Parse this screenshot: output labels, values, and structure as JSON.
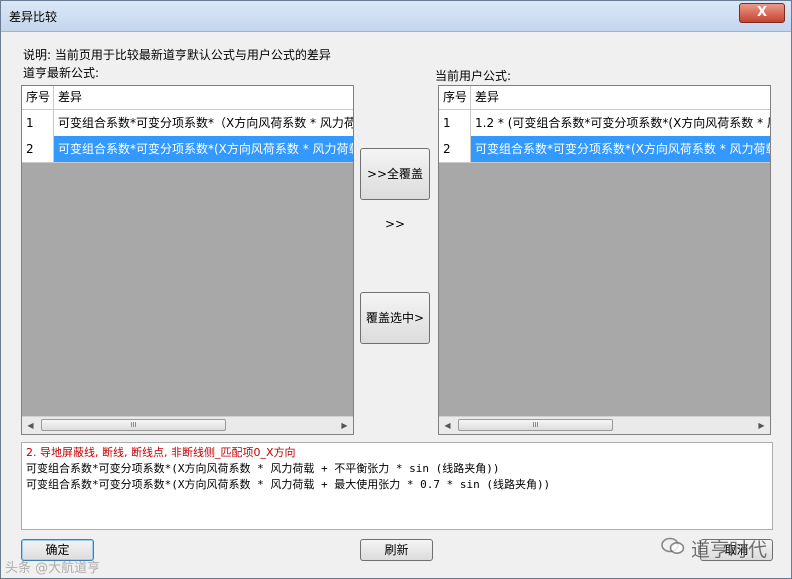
{
  "window": {
    "title": "差异比较",
    "close_label": "X"
  },
  "description": "说明: 当前页用于比较最新道亨默认公式与用户公式的差异",
  "left": {
    "label": "道亨最新公式:",
    "columns": [
      "序号",
      "差异"
    ],
    "rows": [
      {
        "no": "1",
        "text": "可变组合系数*可变分项系数*（X方向风荷系数 * 风力荷"
      },
      {
        "no": "2",
        "text": "可变组合系数*可变分项系数*(X方向风荷系数 * 风力荷载"
      }
    ]
  },
  "right": {
    "label": "当前用户公式:",
    "columns": [
      "序号",
      "差异"
    ],
    "rows": [
      {
        "no": "1",
        "text": "1.2 * (可变组合系数*可变分项系数*(X方向风荷系数 * 风"
      },
      {
        "no": "2",
        "text": "可变组合系数*可变分项系数*(X方向风荷系数 * 风力荷载"
      }
    ]
  },
  "buttons": {
    "overwrite_all": ">>全覆盖>>",
    "overwrite_selected": "覆盖选中>",
    "ok": "确定",
    "refresh": "刷新",
    "cancel": "取消"
  },
  "scroll_thumb_grip": "III",
  "messages": [
    "2. 导地屏蔽线, 断线, 断线点, 非断线侧_匹配项0_X方向",
    "可变组合系数*可变分项系数*(X方向风荷系数 * 风力荷载 + 不平衡张力 * sin (线路夹角))",
    "可变组合系数*可变分项系数*(X方向风荷系数 * 风力荷载 + 最大使用张力 * 0.7 * sin (线路夹角))"
  ],
  "watermarks": {
    "right": "道亨时代",
    "left": "头条 @大航道亨"
  }
}
